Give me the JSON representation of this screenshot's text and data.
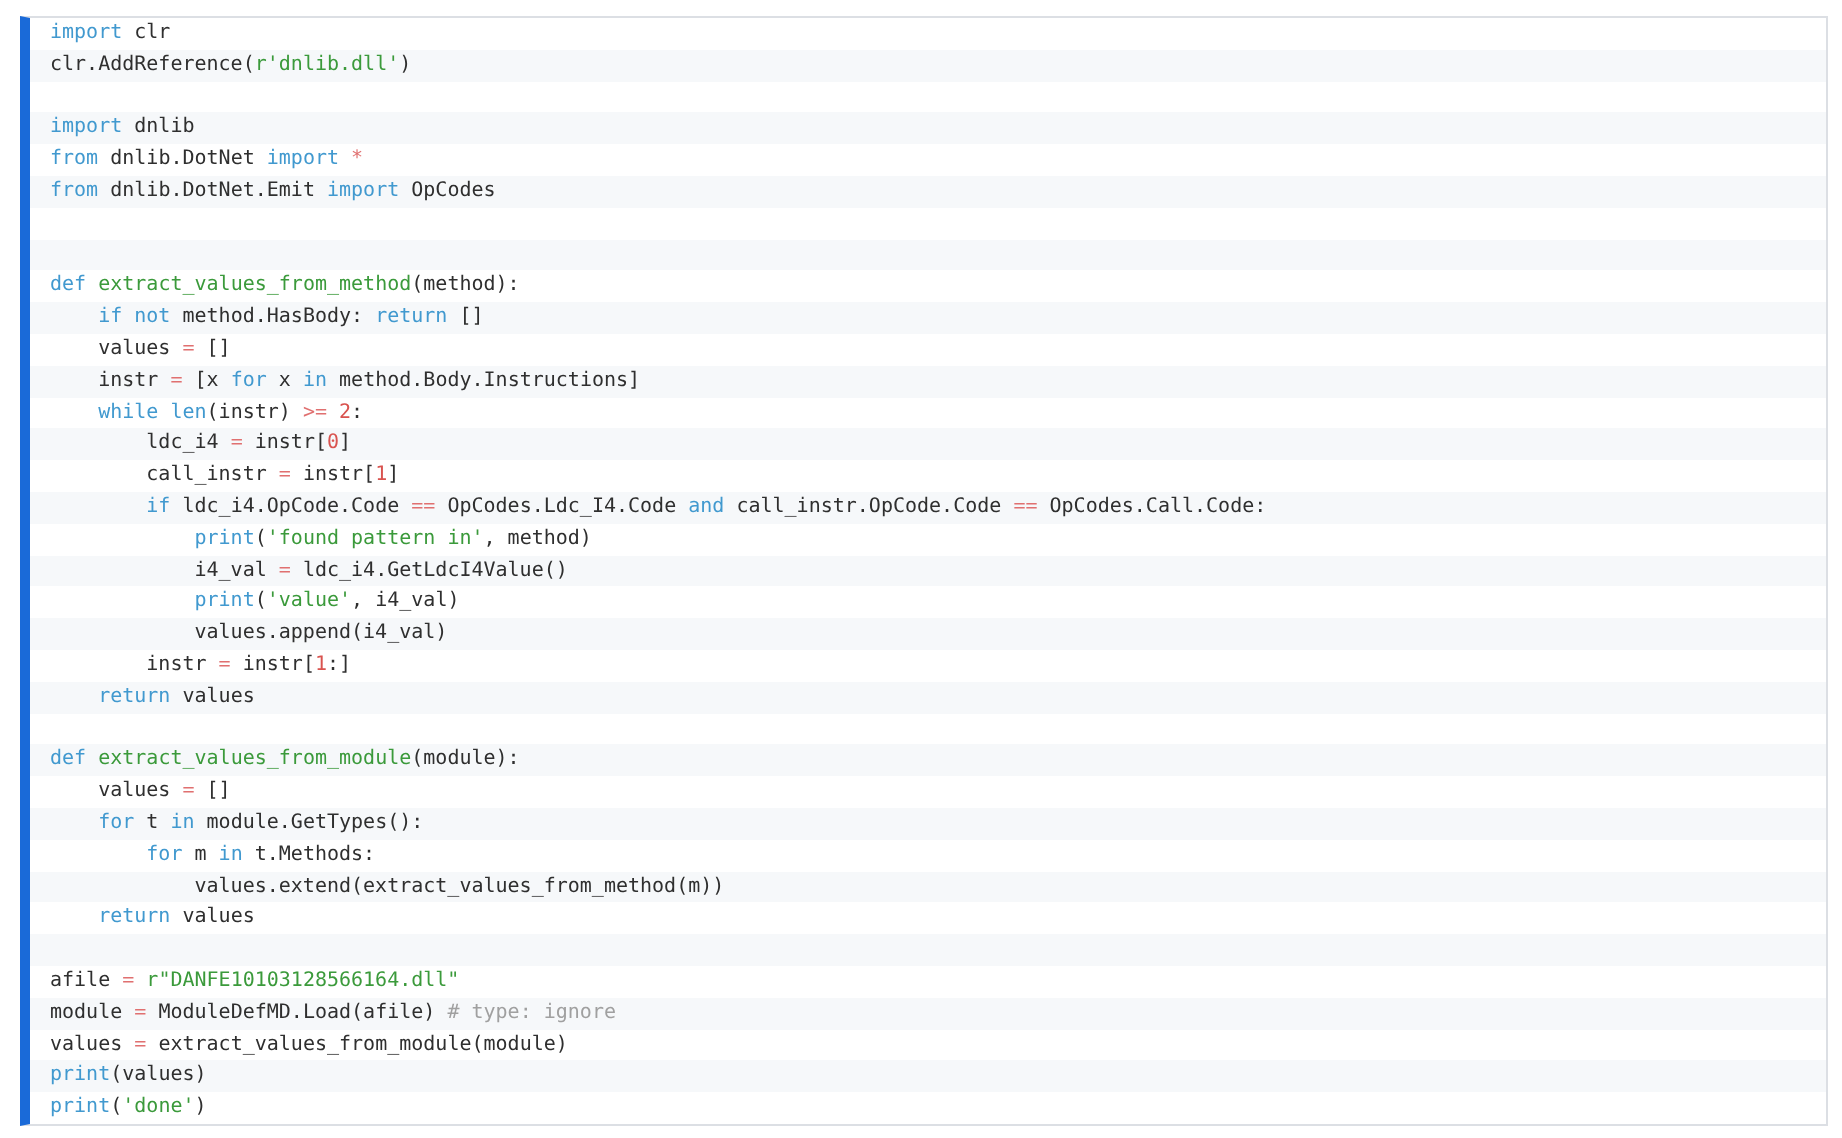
{
  "code_block": {
    "lines": [
      {
        "kind": "code",
        "tokens": [
          {
            "kind": "keyword",
            "text": "import"
          },
          {
            "kind": "plain",
            "text": " clr"
          }
        ]
      },
      {
        "kind": "code",
        "tokens": [
          {
            "kind": "plain",
            "text": "clr.AddReference("
          },
          {
            "kind": "string",
            "text": "r'dnlib.dll'"
          },
          {
            "kind": "plain",
            "text": ")"
          }
        ]
      },
      {
        "kind": "blank"
      },
      {
        "kind": "code",
        "tokens": [
          {
            "kind": "keyword",
            "text": "import"
          },
          {
            "kind": "plain",
            "text": " dnlib"
          }
        ]
      },
      {
        "kind": "code",
        "tokens": [
          {
            "kind": "keyword",
            "text": "from"
          },
          {
            "kind": "plain",
            "text": " dnlib.DotNet "
          },
          {
            "kind": "keyword",
            "text": "import "
          },
          {
            "kind": "operator",
            "text": "*"
          }
        ]
      },
      {
        "kind": "code",
        "tokens": [
          {
            "kind": "keyword",
            "text": "from"
          },
          {
            "kind": "plain",
            "text": " dnlib.DotNet.Emit "
          },
          {
            "kind": "keyword",
            "text": "import"
          },
          {
            "kind": "plain",
            "text": " OpCodes"
          }
        ]
      },
      {
        "kind": "blank"
      },
      {
        "kind": "blank"
      },
      {
        "kind": "code",
        "tokens": [
          {
            "kind": "keyword",
            "text": "def "
          },
          {
            "kind": "function",
            "text": "extract_values_from_method"
          },
          {
            "kind": "plain",
            "text": "(method):"
          }
        ]
      },
      {
        "kind": "code",
        "tokens": [
          {
            "kind": "keyword",
            "text": "    if not"
          },
          {
            "kind": "plain",
            "text": " method.HasBody: "
          },
          {
            "kind": "keyword",
            "text": "return"
          },
          {
            "kind": "plain",
            "text": " []"
          }
        ]
      },
      {
        "kind": "code",
        "tokens": [
          {
            "kind": "plain",
            "text": "    values "
          },
          {
            "kind": "operator",
            "text": "="
          },
          {
            "kind": "plain",
            "text": " []"
          }
        ]
      },
      {
        "kind": "code",
        "tokens": [
          {
            "kind": "plain",
            "text": "    instr "
          },
          {
            "kind": "operator",
            "text": "="
          },
          {
            "kind": "plain",
            "text": " [x "
          },
          {
            "kind": "keyword",
            "text": "for"
          },
          {
            "kind": "plain",
            "text": " x "
          },
          {
            "kind": "keyword",
            "text": "in"
          },
          {
            "kind": "plain",
            "text": " method.Body.Instructions]"
          }
        ]
      },
      {
        "kind": "code",
        "tokens": [
          {
            "kind": "keyword",
            "text": "    while len"
          },
          {
            "kind": "plain",
            "text": "(instr) "
          },
          {
            "kind": "operator",
            "text": ">= "
          },
          {
            "kind": "number",
            "text": "2"
          },
          {
            "kind": "plain",
            "text": ":"
          }
        ]
      },
      {
        "kind": "code",
        "tokens": [
          {
            "kind": "plain",
            "text": "        ldc_i4 "
          },
          {
            "kind": "operator",
            "text": "="
          },
          {
            "kind": "plain",
            "text": " instr["
          },
          {
            "kind": "number",
            "text": "0"
          },
          {
            "kind": "plain",
            "text": "]"
          }
        ]
      },
      {
        "kind": "code",
        "tokens": [
          {
            "kind": "plain",
            "text": "        call_instr "
          },
          {
            "kind": "operator",
            "text": "="
          },
          {
            "kind": "plain",
            "text": " instr["
          },
          {
            "kind": "number",
            "text": "1"
          },
          {
            "kind": "plain",
            "text": "]"
          }
        ]
      },
      {
        "kind": "code",
        "tokens": [
          {
            "kind": "keyword",
            "text": "        if"
          },
          {
            "kind": "plain",
            "text": " ldc_i4.OpCode.Code "
          },
          {
            "kind": "operator",
            "text": "=="
          },
          {
            "kind": "plain",
            "text": " OpCodes.Ldc_I4.Code "
          },
          {
            "kind": "keyword",
            "text": "and"
          },
          {
            "kind": "plain",
            "text": " call_instr.OpCode.Code "
          },
          {
            "kind": "operator",
            "text": "=="
          },
          {
            "kind": "plain",
            "text": " OpCodes.Call.Code:"
          }
        ]
      },
      {
        "kind": "code",
        "tokens": [
          {
            "kind": "keyword",
            "text": "            print"
          },
          {
            "kind": "plain",
            "text": "("
          },
          {
            "kind": "string",
            "text": "'found pattern in'"
          },
          {
            "kind": "plain",
            "text": ", method)"
          }
        ]
      },
      {
        "kind": "code",
        "tokens": [
          {
            "kind": "plain",
            "text": "            i4_val "
          },
          {
            "kind": "operator",
            "text": "="
          },
          {
            "kind": "plain",
            "text": " ldc_i4.GetLdcI4Value()"
          }
        ]
      },
      {
        "kind": "code",
        "tokens": [
          {
            "kind": "keyword",
            "text": "            print"
          },
          {
            "kind": "plain",
            "text": "("
          },
          {
            "kind": "string",
            "text": "'value'"
          },
          {
            "kind": "plain",
            "text": ", i4_val)"
          }
        ]
      },
      {
        "kind": "code",
        "tokens": [
          {
            "kind": "plain",
            "text": "            values.append(i4_val)"
          }
        ]
      },
      {
        "kind": "code",
        "tokens": [
          {
            "kind": "plain",
            "text": "        instr "
          },
          {
            "kind": "operator",
            "text": "="
          },
          {
            "kind": "plain",
            "text": " instr["
          },
          {
            "kind": "number",
            "text": "1"
          },
          {
            "kind": "plain",
            "text": ":]"
          }
        ]
      },
      {
        "kind": "code",
        "tokens": [
          {
            "kind": "keyword",
            "text": "    return"
          },
          {
            "kind": "plain",
            "text": " values"
          }
        ]
      },
      {
        "kind": "blank"
      },
      {
        "kind": "code",
        "tokens": [
          {
            "kind": "keyword",
            "text": "def "
          },
          {
            "kind": "function",
            "text": "extract_values_from_module"
          },
          {
            "kind": "plain",
            "text": "(module):"
          }
        ]
      },
      {
        "kind": "code",
        "tokens": [
          {
            "kind": "plain",
            "text": "    values "
          },
          {
            "kind": "operator",
            "text": "="
          },
          {
            "kind": "plain",
            "text": " []"
          }
        ]
      },
      {
        "kind": "code",
        "tokens": [
          {
            "kind": "keyword",
            "text": "    for"
          },
          {
            "kind": "plain",
            "text": " t "
          },
          {
            "kind": "keyword",
            "text": "in"
          },
          {
            "kind": "plain",
            "text": " module.GetTypes():"
          }
        ]
      },
      {
        "kind": "code",
        "tokens": [
          {
            "kind": "keyword",
            "text": "        for"
          },
          {
            "kind": "plain",
            "text": " m "
          },
          {
            "kind": "keyword",
            "text": "in"
          },
          {
            "kind": "plain",
            "text": " t.Methods:"
          }
        ]
      },
      {
        "kind": "code",
        "tokens": [
          {
            "kind": "plain",
            "text": "            values.extend(extract_values_from_method(m))"
          }
        ]
      },
      {
        "kind": "code",
        "tokens": [
          {
            "kind": "keyword",
            "text": "    return"
          },
          {
            "kind": "plain",
            "text": " values"
          }
        ]
      },
      {
        "kind": "blank"
      },
      {
        "kind": "code",
        "tokens": [
          {
            "kind": "plain",
            "text": "afile "
          },
          {
            "kind": "operator",
            "text": "= "
          },
          {
            "kind": "string",
            "text": "r\"DANFE10103128566164.dll\""
          }
        ]
      },
      {
        "kind": "code",
        "tokens": [
          {
            "kind": "plain",
            "text": "module "
          },
          {
            "kind": "operator",
            "text": "="
          },
          {
            "kind": "plain",
            "text": " ModuleDefMD.Load(afile) "
          },
          {
            "kind": "comment",
            "text": "# type: ignore"
          }
        ]
      },
      {
        "kind": "code",
        "tokens": [
          {
            "kind": "plain",
            "text": "values "
          },
          {
            "kind": "operator",
            "text": "="
          },
          {
            "kind": "plain",
            "text": " extract_values_from_module(module)"
          }
        ]
      },
      {
        "kind": "code",
        "tokens": [
          {
            "kind": "keyword",
            "text": "print"
          },
          {
            "kind": "plain",
            "text": "(values)"
          }
        ]
      },
      {
        "kind": "code",
        "tokens": [
          {
            "kind": "keyword",
            "text": "print"
          },
          {
            "kind": "plain",
            "text": "("
          },
          {
            "kind": "string",
            "text": "'done'"
          },
          {
            "kind": "plain",
            "text": ")"
          }
        ]
      }
    ]
  }
}
